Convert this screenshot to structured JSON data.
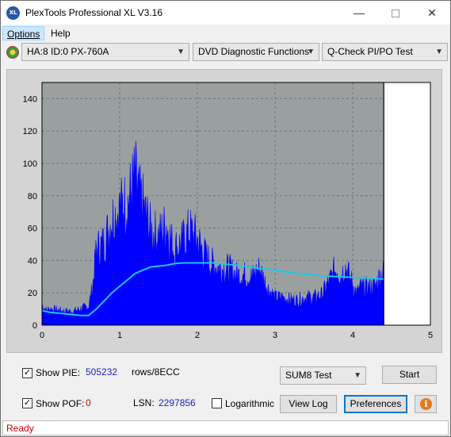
{
  "window": {
    "title": "PlexTools Professional XL V3.16",
    "icon_label": "XL",
    "minimize_icon": "minimize-icon",
    "maximize_icon": "maximize-icon",
    "close_icon": "close-icon"
  },
  "menu": {
    "items": [
      {
        "label": "Options"
      },
      {
        "label": "Help"
      }
    ]
  },
  "toolbar": {
    "drive": "HA:8 ID:0  PX-760A",
    "function": "DVD Diagnostic Functions",
    "test": "Q-Check PI/PO Test"
  },
  "controls": {
    "show_pie_label": "Show PIE:",
    "show_pie_checked": true,
    "pie_value": "505232",
    "rows_label": "rows/8ECC",
    "show_pof_label": "Show POF:",
    "show_pof_checked": true,
    "pof_value": "0",
    "lsn_label": "LSN:",
    "lsn_value": "2297856",
    "logarithmic_label": "Logarithmic",
    "logarithmic_checked": false,
    "sum_select": "SUM8 Test",
    "start_button": "Start",
    "view_log_button": "View Log",
    "preferences_button": "Preferences",
    "info_icon": "info-icon",
    "info_glyph": "i"
  },
  "status": {
    "text": "Ready"
  },
  "colors": {
    "bar_fill": "#0000ff",
    "avg_line": "#1fc6e8",
    "plot_bg": "#9aa0a0",
    "status_text": "#d40000",
    "pie_value": "#1e1eb4",
    "pof_value": "#d40000"
  },
  "chart_data": {
    "type": "area",
    "title": "",
    "xlabel": "",
    "ylabel": "",
    "xlim": [
      0,
      5
    ],
    "ylim": [
      0,
      150
    ],
    "x_ticks": [
      "0",
      "1",
      "2",
      "3",
      "4",
      "5"
    ],
    "y_ticks": [
      "0",
      "20",
      "40",
      "60",
      "80",
      "100",
      "120",
      "140"
    ],
    "grid": true,
    "end_marker_x": 4.4,
    "series": [
      {
        "name": "",
        "kind": "pie_bars",
        "x": [
          0.0,
          0.05,
          0.1,
          0.2,
          0.3,
          0.4,
          0.5,
          0.55,
          0.6,
          0.65,
          0.7,
          0.8,
          0.9,
          1.0,
          1.05,
          1.1,
          1.15,
          1.2,
          1.25,
          1.3,
          1.35,
          1.4,
          1.5,
          1.6,
          1.7,
          1.8,
          1.9,
          2.0,
          2.1,
          2.2,
          2.3,
          2.4,
          2.5,
          2.6,
          2.7,
          2.8,
          2.9,
          3.0,
          3.1,
          3.2,
          3.3,
          3.4,
          3.5,
          3.6,
          3.7,
          3.75,
          3.8,
          3.85,
          3.9,
          3.95,
          4.0,
          4.05,
          4.1,
          4.2,
          4.3,
          4.35,
          4.4
        ],
        "y": [
          16,
          12,
          13,
          12,
          11,
          11,
          13,
          14,
          15,
          30,
          60,
          65,
          85,
          92,
          97,
          96,
          108,
          118,
          102,
          95,
          85,
          75,
          70,
          80,
          60,
          65,
          75,
          68,
          55,
          48,
          45,
          45,
          40,
          40,
          38,
          45,
          30,
          22,
          22,
          20,
          20,
          22,
          22,
          24,
          35,
          42,
          45,
          40,
          47,
          40,
          33,
          25,
          30,
          30,
          32,
          40,
          42
        ]
      },
      {
        "name": "",
        "kind": "pie_avg",
        "x": [
          0.0,
          0.1,
          0.2,
          0.3,
          0.4,
          0.5,
          0.6,
          0.7,
          0.8,
          0.9,
          1.0,
          1.1,
          1.2,
          1.3,
          1.4,
          1.5,
          1.6,
          1.7,
          1.8,
          1.9,
          2.0,
          2.1,
          2.2,
          2.4,
          2.6,
          2.8,
          3.0,
          3.2,
          3.4,
          3.6,
          3.8,
          4.0,
          4.2,
          4.4
        ],
        "y": [
          9,
          8,
          7.5,
          7,
          6.5,
          6,
          6,
          10,
          15,
          20,
          24,
          28,
          32,
          34,
          36,
          36.5,
          37,
          38,
          38.5,
          38.5,
          38.5,
          38.5,
          38.5,
          37.5,
          36.5,
          35,
          34,
          32.5,
          31.5,
          30.5,
          30,
          29.5,
          29,
          28.5
        ]
      }
    ]
  }
}
